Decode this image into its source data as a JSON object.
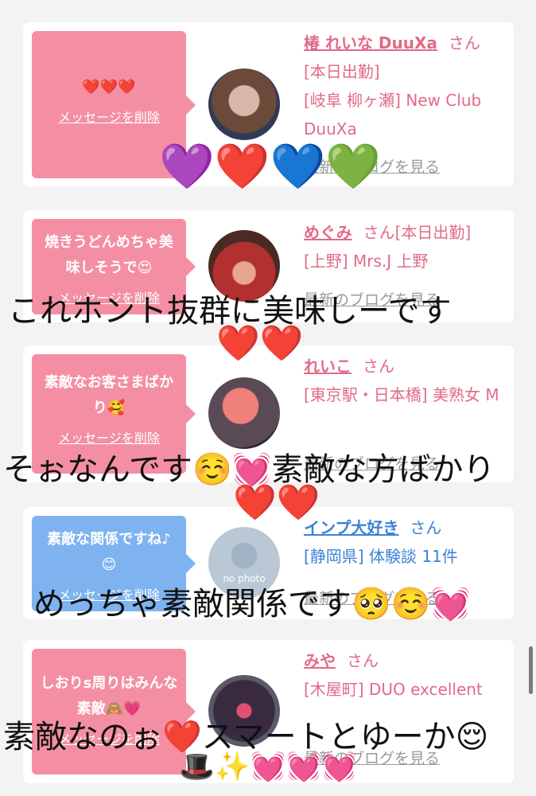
{
  "posts": [
    {
      "message": "❤️❤️❤️",
      "delete_label": "メッセージを削除",
      "name": "椿 れいな DuuXa",
      "honorific": "さん",
      "status": "[本日出勤]",
      "detail": "[岐阜 柳ヶ瀬] New Club DuuXa",
      "blog_link": "最新のブログを見る",
      "bubble_color": "pink"
    },
    {
      "message": "焼きうどんめちゃ美味しそうで😍",
      "delete_label": "メッセージを削除",
      "name": "めぐみ",
      "honorific": "さん",
      "status": "[本日出勤]",
      "detail": "[上野] Mrs.J 上野",
      "blog_link": "最新のブログを見る",
      "bubble_color": "pink"
    },
    {
      "message": "素敵なお客さまばかり🥰",
      "delete_label": "メッセージを削除",
      "name": "れいこ",
      "honorific": "さん",
      "status": "",
      "detail": "[東京駅・日本橋] 美熟女 M",
      "blog_link": "最新のブログを見る",
      "bubble_color": "pink"
    },
    {
      "message": "素敵な関係ですね♪😊",
      "delete_label": "メッセージを削除",
      "name": "インプ大好き",
      "honorific": "さん",
      "status": "",
      "detail": "[静岡県] 体験談 11件",
      "blog_link": "最新のブログを見る",
      "avatar_text": "no photo",
      "bubble_color": "blue"
    },
    {
      "message": "しおりs周りはみんな素敵🙈💗",
      "delete_label": "メッセージを削除",
      "name": "みや",
      "honorific": "さん",
      "status": "",
      "detail": "[木屋町] DUO excellent",
      "blog_link": "最新のブログを見る",
      "bubble_color": "pink"
    }
  ],
  "overlays": {
    "hearts_row1": "💜❤️💙💚",
    "text1": "これホント抜群に美味しーです",
    "hearts_row2": "❤️❤️",
    "text2": "そぉなんです☺️💓素敵な方ばかり",
    "hearts_row3": "❤️❤️",
    "text3": "めっちゃ素敵関係です🥺☺️💓",
    "text4": "素敵なのぉ❤️スマートとゆーか😌",
    "emoji_row5": "🎩✨💓💓💓"
  },
  "colors": {
    "pink_link": "#e26a86",
    "blue_link": "#3b82d6",
    "bubble_pink": "#f48fa3",
    "bubble_blue": "#7fb3f0"
  }
}
